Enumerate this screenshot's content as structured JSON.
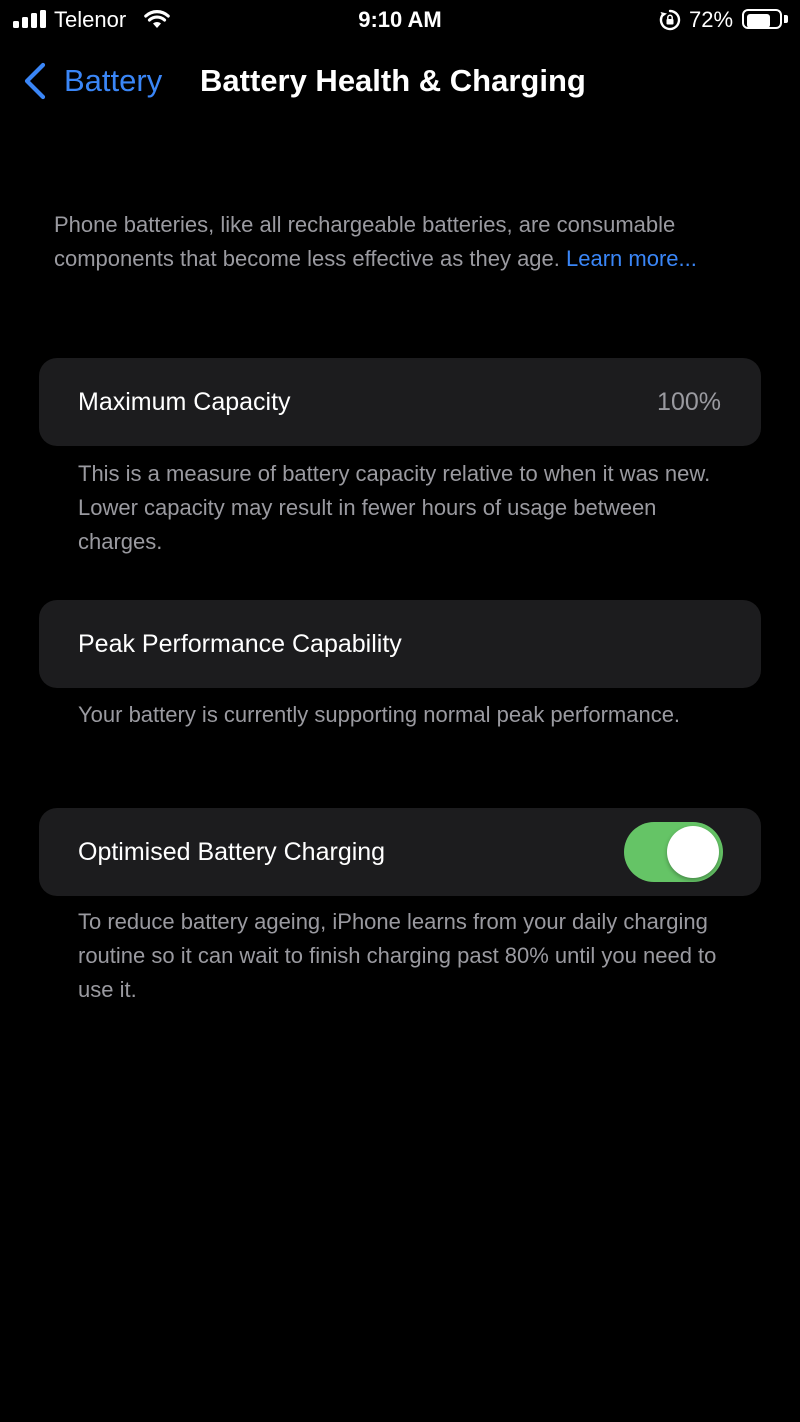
{
  "status_bar": {
    "carrier": "Telenor",
    "time": "9:10 AM",
    "battery_percent_text": "72%",
    "battery_level": 0.72,
    "icons": [
      "signal-bars-icon",
      "wifi-icon",
      "rotation-lock-icon",
      "battery-icon"
    ]
  },
  "nav": {
    "back_label": "Battery",
    "title": "Battery Health & Charging"
  },
  "intro": {
    "text": "Phone batteries, like all rechargeable batteries, are consumable components that become less effective as they age. ",
    "link": "Learn more..."
  },
  "max_capacity": {
    "label": "Maximum Capacity",
    "value": "100%",
    "footnote": "This is a measure of battery capacity relative to when it was new. Lower capacity may result in fewer hours of usage between charges."
  },
  "peak_performance": {
    "label": "Peak Performance Capability",
    "footnote": "Your battery is currently supporting normal peak performance."
  },
  "optimised_charging": {
    "label": "Optimised Battery Charging",
    "enabled": true,
    "footnote": "To reduce battery ageing, iPhone learns from your daily charging routine so it can wait to finish charging past 80% until you need to use it."
  },
  "colors": {
    "background": "#000000",
    "cell": "#1c1c1e",
    "accent": "#3a86f7",
    "secondary_text": "#9a9aa0",
    "toggle_on": "#65c466"
  }
}
